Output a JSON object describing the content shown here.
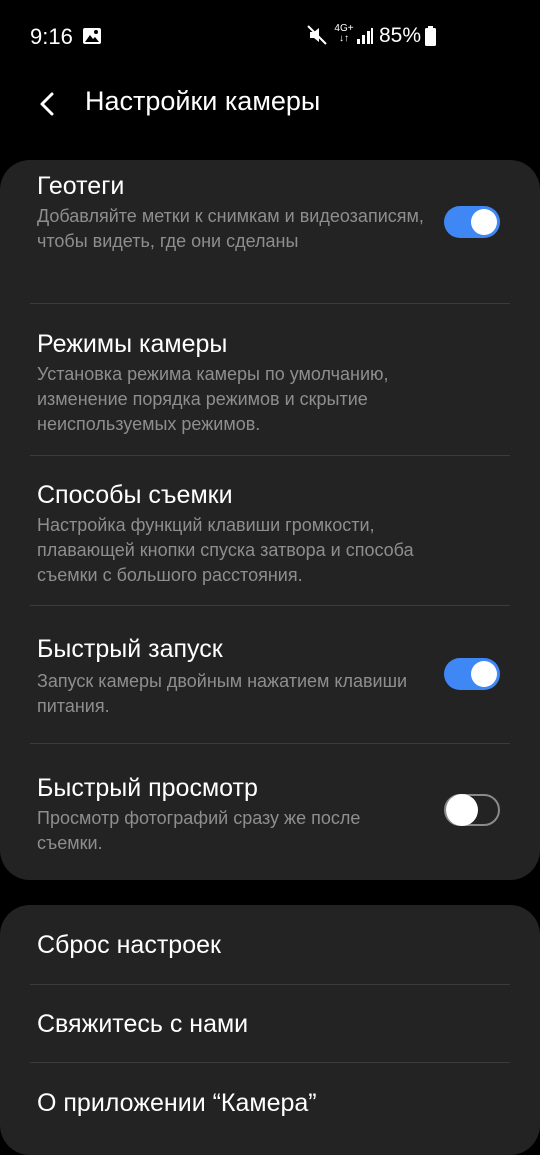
{
  "status": {
    "time": "9:16",
    "network": "4G+",
    "battery": "85%"
  },
  "header": {
    "title": "Настройки камеры"
  },
  "settings": [
    {
      "title": "Геотеги",
      "desc": "Добавляйте метки к снимкам и видеозаписям, чтобы видеть, где они сделаны",
      "toggle": true
    },
    {
      "title": "Режимы камеры",
      "desc": "Установка режима камеры по умолчанию, изменение порядка режимов и скрытие неиспользуемых режимов."
    },
    {
      "title": "Способы съемки",
      "desc": "Настройка функций клавиши громкости, плавающей кнопки спуска затвора и способа съемки с большого расстояния."
    },
    {
      "title": "Быстрый запуск",
      "desc": "Запуск камеры двойным нажатием клавиши питания.",
      "toggle": true
    },
    {
      "title": "Быстрый просмотр",
      "desc": "Просмотр фотографий сразу же после съемки.",
      "toggle": false
    }
  ],
  "more": [
    {
      "title": "Сброс настроек"
    },
    {
      "title": "Свяжитесь с нами"
    },
    {
      "title": "О приложении “Камера”"
    }
  ],
  "colors": {
    "accent": "#3f87f5",
    "card": "#232323",
    "background": "#000000"
  }
}
